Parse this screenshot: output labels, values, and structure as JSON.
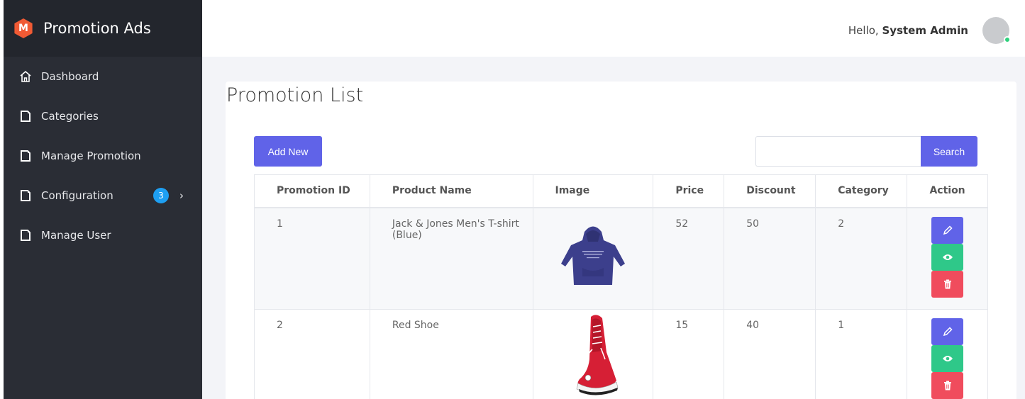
{
  "app": {
    "title": "Promotion Ads",
    "logo_letter": "M"
  },
  "sidebar": {
    "items": [
      {
        "label": "Dashboard",
        "icon": "home-icon"
      },
      {
        "label": "Categories",
        "icon": "page-icon"
      },
      {
        "label": "Manage Promotion",
        "icon": "page-icon"
      },
      {
        "label": "Configuration",
        "icon": "page-icon",
        "badge": "3",
        "arrow": "›"
      },
      {
        "label": "Manage User",
        "icon": "page-icon"
      }
    ]
  },
  "header": {
    "greeting": "Hello,",
    "user_name": "System Admin"
  },
  "page": {
    "title": "Promotion List",
    "add_button": "Add New",
    "search_button": "Search",
    "search_value": ""
  },
  "table": {
    "headers": [
      "Promotion ID",
      "Product Name",
      "Image",
      "Price",
      "Discount",
      "Category",
      "Action"
    ],
    "rows": [
      {
        "id": "1",
        "name": "Jack & Jones Men's T-shirt (Blue)",
        "image": "hoodie-image",
        "price": "52",
        "discount": "50",
        "category": "2"
      },
      {
        "id": "2",
        "name": "Red Shoe",
        "image": "red-shoe-image",
        "price": "15",
        "discount": "40",
        "category": "1"
      }
    ]
  },
  "colors": {
    "sidebar_bg": "#2a2d35",
    "primary": "#6063e8",
    "success": "#2fc889",
    "danger": "#f04c5d",
    "badge": "#1e9ff2",
    "logo": "#f05a34"
  }
}
